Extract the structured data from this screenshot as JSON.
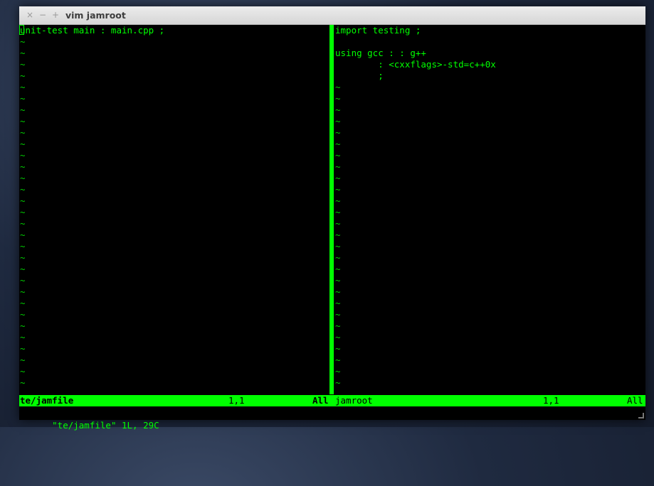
{
  "window": {
    "title": "vim jamroot"
  },
  "titlebar": {
    "close_icon": "×",
    "minimize_icon": "−",
    "maximize_icon": "+"
  },
  "left_pane": {
    "lines": [
      "unit-test main : main.cpp ;"
    ],
    "tilde": "~",
    "tilde_count": 31
  },
  "right_pane": {
    "lines": [
      "import testing ;",
      "",
      "using gcc : : g++",
      "        : <cxxflags>-std=c++0x",
      "        ;"
    ],
    "tilde": "~",
    "tilde_count": 27
  },
  "statusline": {
    "left_file": "te/jamfile",
    "left_pos": "1,1",
    "left_scroll": "All",
    "right_file": "jamroot",
    "right_pos": "1,1",
    "right_scroll": "All"
  },
  "cmdline": {
    "message": "\"te/jamfile\" 1L, 29C"
  },
  "colors": {
    "fg": "#00ff00",
    "bg": "#000000"
  }
}
